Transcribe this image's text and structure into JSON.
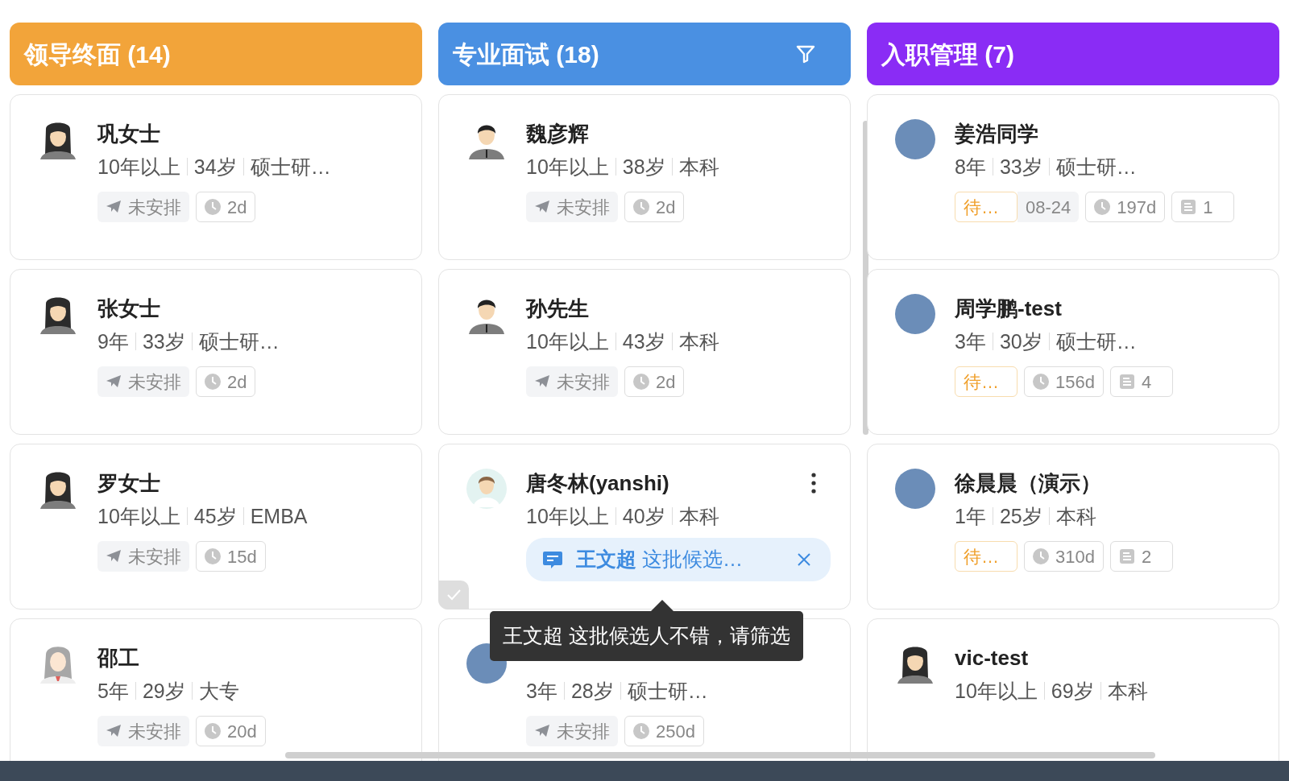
{
  "columns": [
    {
      "title": "领导终面 (14)",
      "color": "#f2a43a",
      "filter": false,
      "cards": [
        {
          "name": "巩女士",
          "kind": "woman",
          "meta": [
            "10年以上",
            "34岁",
            "硕士研…"
          ],
          "tags": [
            {
              "kind": "schedule",
              "text": "未安排"
            },
            {
              "kind": "days",
              "text": "2d"
            }
          ]
        },
        {
          "name": "张女士",
          "kind": "woman",
          "meta": [
            "9年",
            "33岁",
            "硕士研…"
          ],
          "tags": [
            {
              "kind": "schedule",
              "text": "未安排"
            },
            {
              "kind": "days",
              "text": "2d"
            }
          ]
        },
        {
          "name": "罗女士",
          "kind": "woman",
          "meta": [
            "10年以上",
            "45岁",
            "EMBA"
          ],
          "tags": [
            {
              "kind": "schedule",
              "text": "未安排"
            },
            {
              "kind": "days",
              "text": "15d"
            }
          ]
        },
        {
          "name": "邵工",
          "kind": "lady",
          "meta": [
            "5年",
            "29岁",
            "大专"
          ],
          "tags": [
            {
              "kind": "schedule",
              "text": "未安排"
            },
            {
              "kind": "days",
              "text": "20d"
            }
          ]
        }
      ]
    },
    {
      "title": "专业面试 (18)",
      "color": "#4a90e2",
      "filter": true,
      "cards": [
        {
          "name": "魏彦辉",
          "kind": "man",
          "meta": [
            "10年以上",
            "38岁",
            "本科"
          ],
          "tags": [
            {
              "kind": "schedule",
              "text": "未安排"
            },
            {
              "kind": "days",
              "text": "2d"
            }
          ]
        },
        {
          "name": "孙先生",
          "kind": "man",
          "meta": [
            "10年以上",
            "43岁",
            "本科"
          ],
          "tags": [
            {
              "kind": "schedule",
              "text": "未安排"
            },
            {
              "kind": "days",
              "text": "2d"
            }
          ]
        },
        {
          "name": "唐冬林(yanshi)",
          "kind": "cartoon",
          "menu": true,
          "meta": [
            "10年以上",
            "40岁",
            "本科"
          ],
          "comment": {
            "text": "**王文超** 这批候选…",
            "tooltip": "王文超 这批候选人不错，请筛选"
          },
          "select_box": {
            "checked": false
          }
        },
        {
          "kind": "photo",
          "meta": [
            "3年",
            "28岁",
            "硕士研…"
          ],
          "tags": [
            {
              "kind": "schedule",
              "text": "未安排"
            },
            {
              "kind": "days",
              "text": "250d"
            }
          ]
        }
      ]
    },
    {
      "title": "入职管理 (7)",
      "color": "#8a2cf5",
      "filter": false,
      "cards": [
        {
          "name": "姜浩同学",
          "kind": "photo",
          "meta": [
            "8年",
            "33岁",
            "硕士研…"
          ],
          "tags": [
            {
              "kind": "status",
              "text": "待…"
            },
            {
              "kind": "date",
              "text": "08-24"
            },
            {
              "kind": "days",
              "text": "197d"
            },
            {
              "kind": "notes",
              "text": "1"
            }
          ]
        },
        {
          "name": "周学鹏-test",
          "kind": "photo",
          "meta": [
            "3年",
            "30岁",
            "硕士研…"
          ],
          "tags": [
            {
              "kind": "status",
              "text": "待…"
            },
            {
              "kind": "days",
              "text": "156d"
            },
            {
              "kind": "notes",
              "text": "4"
            }
          ]
        },
        {
          "name": "徐晨晨（演示）",
          "kind": "photo",
          "meta": [
            "1年",
            "25岁",
            "本科"
          ],
          "tags": [
            {
              "kind": "status",
              "text": "待…"
            },
            {
              "kind": "days",
              "text": "310d"
            },
            {
              "kind": "notes",
              "text": "2"
            }
          ]
        },
        {
          "name": "vic-test",
          "kind": "woman",
          "meta": [
            "10年以上",
            "69岁",
            "本科"
          ]
        }
      ]
    }
  ]
}
